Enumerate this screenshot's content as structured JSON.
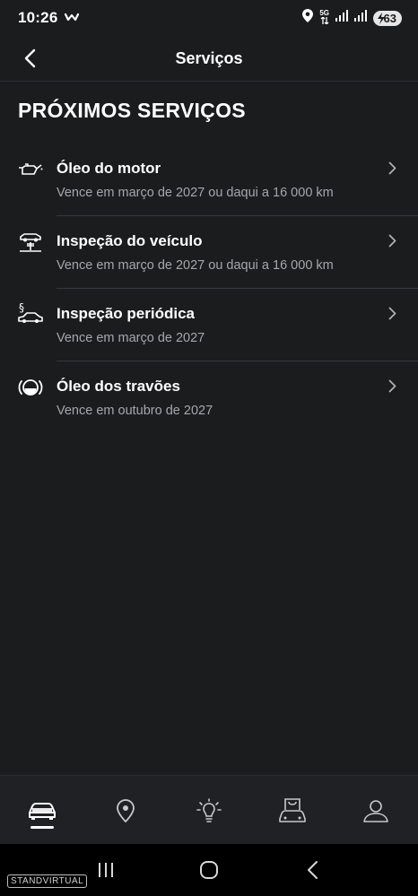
{
  "status_bar": {
    "time": "10:26",
    "network": "5G",
    "battery": "63"
  },
  "header": {
    "title": "Serviços"
  },
  "section": {
    "title": "PRÓXIMOS SERVIÇOS"
  },
  "services": [
    {
      "name": "Óleo do motor",
      "due": "Vence em março de 2027 ou daqui a 16 000 km",
      "icon": "engine-oil-icon"
    },
    {
      "name": "Inspeção do veículo",
      "due": "Vence em março de 2027 ou daqui a 16 000 km",
      "icon": "vehicle-lift-icon"
    },
    {
      "name": "Inspeção periódica",
      "due": "Vence em março de 2027",
      "icon": "legal-inspection-icon"
    },
    {
      "name": "Óleo dos travões",
      "due": "Vence em outubro de 2027",
      "icon": "brake-fluid-icon"
    }
  ],
  "bottom_nav": [
    "car-icon",
    "location-pin-icon",
    "lightbulb-icon",
    "shop-bag-car-icon",
    "profile-icon"
  ],
  "watermark": "STANDVIRTUAL",
  "colors": {
    "background": "#1b1c1e",
    "secondary_text": "#a6a7aa",
    "divider": "#37383b"
  }
}
